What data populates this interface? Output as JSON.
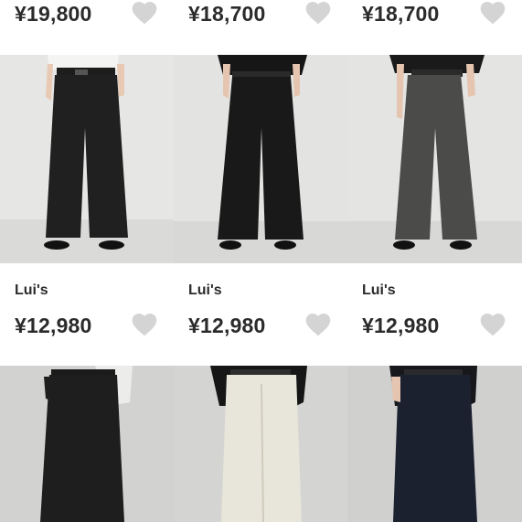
{
  "products_row_top": [
    {
      "price": "¥19,800"
    },
    {
      "price": "¥18,700"
    },
    {
      "price": "¥18,700"
    }
  ],
  "products_row_mid": [
    {
      "brand": "Lui's",
      "price": "¥12,980"
    },
    {
      "brand": "Lui's",
      "price": "¥12,980"
    },
    {
      "brand": "Lui's",
      "price": "¥12,980"
    }
  ],
  "icons": {
    "favorite": "heart-icon"
  },
  "colors": {
    "heart": "#d4d4d4",
    "text": "#2b2b2b"
  }
}
